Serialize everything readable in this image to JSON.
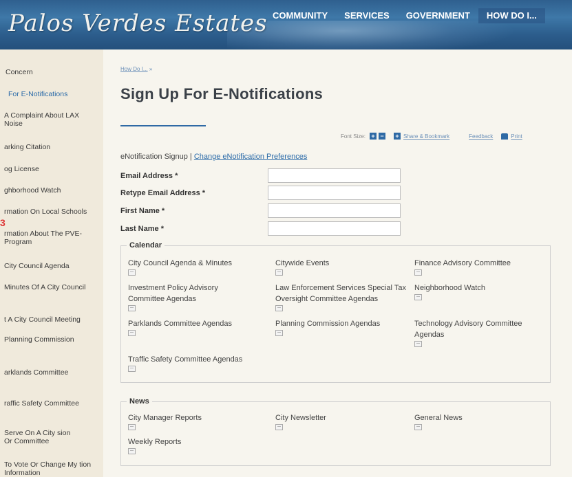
{
  "header": {
    "logo_text": "Palos Verdes Estates",
    "nav": [
      "COMMUNITY",
      "SERVICES",
      "GOVERNMENT",
      "HOW DO I..."
    ]
  },
  "sidebar": {
    "marker": "3",
    "items": [
      {
        "label": "Concern"
      },
      {
        "label": "For E-Notifications"
      },
      {
        "label": "A Complaint About LAX Noise"
      },
      {
        "label": "arking Citation"
      },
      {
        "label": "og License"
      },
      {
        "label": "ghborhood Watch"
      },
      {
        "label": "rmation On Local Schools"
      },
      {
        "label": "rmation About The PVE- Program"
      },
      {
        "label": "City Council Agenda"
      },
      {
        "label": "Minutes Of A City Council"
      },
      {
        "label": "t A City Council Meeting"
      },
      {
        "label": "Planning Commission"
      },
      {
        "label": "arklands Committee"
      },
      {
        "label": "raffic Safety Committee"
      },
      {
        "label": "Serve On A City sion Or Committee"
      },
      {
        "label": "To Vote Or Change My tion Information"
      }
    ]
  },
  "main": {
    "breadcrumb": "How Do I...",
    "breadcrumb_sep": "»",
    "title": "Sign Up For E-Notifications",
    "toolbar": {
      "font_size_label": "Font Size:",
      "font_plus": "+",
      "font_minus": "−",
      "share_icon": "+",
      "share_label": "Share & Bookmark",
      "feedback_label": "Feedback",
      "print_label": "Print"
    },
    "signup_text": "eNotification Signup",
    "signup_sep": "|",
    "change_prefs": "Change eNotification Preferences",
    "fields": [
      {
        "label": "Email Address *",
        "value": ""
      },
      {
        "label": "Retype Email Address *",
        "value": ""
      },
      {
        "label": "First Name *",
        "value": ""
      },
      {
        "label": "Last Name *",
        "value": ""
      }
    ],
    "calendar": {
      "legend": "Calendar",
      "items": [
        "City Council Agenda & Minutes",
        "Citywide Events",
        "Finance Advisory Committee",
        "Investment Policy Advisory Committee Agendas",
        "Law Enforcement Services Special Tax Oversight Committee Agendas",
        "Neighborhood Watch",
        "Parklands Committee Agendas",
        "Planning Commission Agendas",
        "Technology Advisory Committee Agendas",
        "Traffic Safety Committee Agendas"
      ]
    },
    "news": {
      "legend": "News",
      "items": [
        "City Manager Reports",
        "City Newsletter",
        "General News",
        "Weekly Reports"
      ]
    }
  }
}
